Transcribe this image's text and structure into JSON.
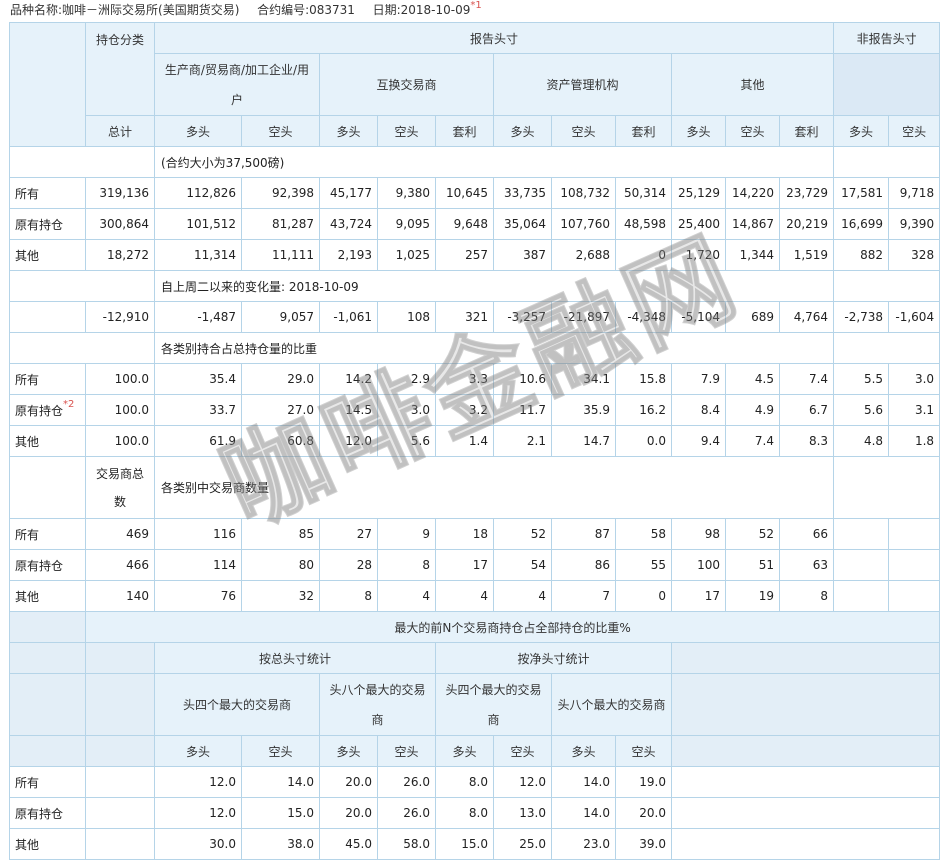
{
  "meta": {
    "product_label": "品种名称:",
    "product_value": "咖啡－洲际交易所(美国期货交易)",
    "contract_label": "合约编号:",
    "contract_value": "083731",
    "date_label": "日期:",
    "date_value": "2018-10-09",
    "note1": "*1"
  },
  "headers": {
    "reportable": "报告头寸",
    "non_reportable": "非报告头寸",
    "position_class": "持仓分类",
    "producer": "生产商/贸易商/加工企业/用户",
    "swap": "互换交易商",
    "managed": "资产管理机构",
    "other_rep": "其他",
    "total": "总计",
    "long": "多头",
    "short": "空头",
    "spread": "套利"
  },
  "sections": {
    "contract_size": "(合约大小为37,500磅)",
    "change": "自上周二以来的变化量: 2018-10-09",
    "percent": "各类别持合占总持仓量的比重",
    "traders_label": "交易商总数",
    "traders_note": "各类别中交易商数量",
    "concentration": "最大的前N个交易商持仓占全部持仓的比重%",
    "by_gross": "按总头寸统计",
    "by_net": "按净头寸统计",
    "top4": "头四个最大的交易商",
    "top8": "头八个最大的交易商"
  },
  "notes": {
    "note2": "*2"
  },
  "rows": {
    "positions": [
      {
        "label": "所有",
        "cells": [
          "319,136",
          "112,826",
          "92,398",
          "45,177",
          "9,380",
          "10,645",
          "33,735",
          "108,732",
          "50,314",
          "25,129",
          "14,220",
          "23,729",
          "17,581",
          "9,718"
        ]
      },
      {
        "label": "原有持仓",
        "cells": [
          "300,864",
          "101,512",
          "81,287",
          "43,724",
          "9,095",
          "9,648",
          "35,064",
          "107,760",
          "48,598",
          "25,400",
          "14,867",
          "20,219",
          "16,699",
          "9,390"
        ]
      },
      {
        "label": "其他",
        "cells": [
          "18,272",
          "11,314",
          "11,111",
          "2,193",
          "1,025",
          "257",
          "387",
          "2,688",
          "0",
          "1,720",
          "1,344",
          "1,519",
          "882",
          "328"
        ]
      }
    ],
    "change": {
      "label": "",
      "cells": [
        "-12,910",
        "-1,487",
        "9,057",
        "-1,061",
        "108",
        "321",
        "-3,257",
        "-21,897",
        "-4,348",
        "-5,104",
        "689",
        "4,764",
        "-2,738",
        "-1,604"
      ]
    },
    "percent": [
      {
        "label": "所有",
        "cells": [
          "100.0",
          "35.4",
          "29.0",
          "14.2",
          "2.9",
          "3.3",
          "10.6",
          "34.1",
          "15.8",
          "7.9",
          "4.5",
          "7.4",
          "5.5",
          "3.0"
        ]
      },
      {
        "label": "原有持仓",
        "cells": [
          "100.0",
          "33.7",
          "27.0",
          "14.5",
          "3.0",
          "3.2",
          "11.7",
          "35.9",
          "16.2",
          "8.4",
          "4.9",
          "6.7",
          "5.6",
          "3.1"
        ]
      },
      {
        "label": "其他",
        "cells": [
          "100.0",
          "61.9",
          "60.8",
          "12.0",
          "5.6",
          "1.4",
          "2.1",
          "14.7",
          "0.0",
          "9.4",
          "7.4",
          "8.3",
          "4.8",
          "1.8"
        ]
      }
    ],
    "traders": [
      {
        "label": "所有",
        "cells": [
          "469",
          "116",
          "85",
          "27",
          "9",
          "18",
          "52",
          "87",
          "58",
          "98",
          "52",
          "66"
        ]
      },
      {
        "label": "原有持仓",
        "cells": [
          "466",
          "114",
          "80",
          "28",
          "8",
          "17",
          "54",
          "86",
          "55",
          "100",
          "51",
          "63"
        ]
      },
      {
        "label": "其他",
        "cells": [
          "140",
          "76",
          "32",
          "8",
          "4",
          "4",
          "4",
          "7",
          "0",
          "17",
          "19",
          "8"
        ]
      }
    ],
    "concentration": [
      {
        "label": "所有",
        "cells": [
          "12.0",
          "14.0",
          "20.0",
          "26.0",
          "8.0",
          "12.0",
          "14.0",
          "19.0"
        ]
      },
      {
        "label": "原有持仓",
        "cells": [
          "12.0",
          "15.0",
          "20.0",
          "26.0",
          "8.0",
          "13.0",
          "14.0",
          "20.0"
        ]
      },
      {
        "label": "其他",
        "cells": [
          "30.0",
          "38.0",
          "45.0",
          "58.0",
          "15.0",
          "25.0",
          "23.0",
          "39.0"
        ]
      }
    ]
  },
  "watermark": "咖啡金融网"
}
